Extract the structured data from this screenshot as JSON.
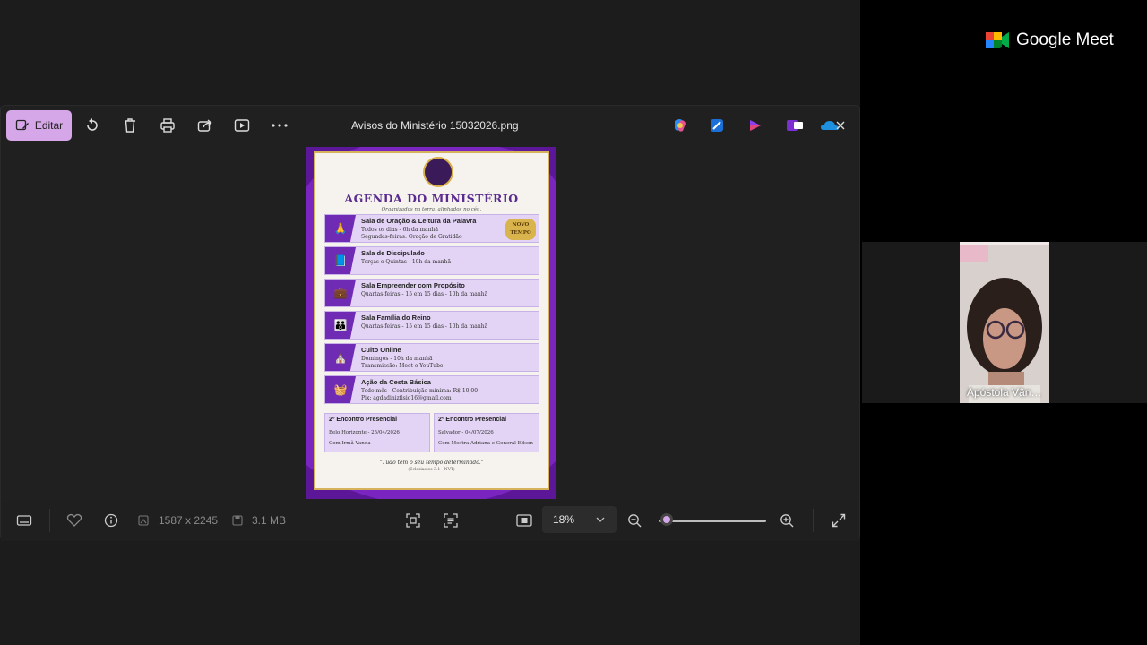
{
  "meet": {
    "brand": "Google Meet",
    "participant_name": "Apóstola Vân…"
  },
  "viewer": {
    "edit_label": "Editar",
    "filename": "Avisos do Ministério 15032026.png",
    "dimensions": "1587 x 2245",
    "filesize": "3.1 MB",
    "zoom": "18%",
    "zoom_level": 0.03
  },
  "poster": {
    "title": "AGENDA DO MINISTÉRIO",
    "subtitle": "Organizados na terra, alinhados no céu.",
    "badge": "NOVO TEMPO",
    "rows": [
      {
        "title": "Sala de Oração & Leitura da Palavra",
        "l1": "Todos os dias - 6h da manhã",
        "l2": "Segundas-feiras: Oração de Gratidão",
        "icon": "praying-hands-icon",
        "glyph": "🙏"
      },
      {
        "title": "Sala de Discipulado",
        "l1": "Terças e Quintas - 10h da manhã",
        "l2": "",
        "icon": "book-icon",
        "glyph": "📘"
      },
      {
        "title": "Sala Empreender com Propósito",
        "l1": "Quartas-feiras - 15 em 15 dias - 10h da manhã",
        "l2": "",
        "icon": "briefcase-icon",
        "glyph": "💼"
      },
      {
        "title": "Sala Família do Reino",
        "l1": "Quartas-feiras - 15 em 15 dias - 10h da manhã",
        "l2": "",
        "icon": "family-icon",
        "glyph": "👪"
      },
      {
        "title": "Culto Online",
        "l1": "Domingos - 10h da manhã",
        "l2": "Transmissão: Meet e YouTube",
        "icon": "church-icon",
        "glyph": "⛪"
      },
      {
        "title": "Ação da Cesta Básica",
        "l1": "Todo mês - Contribuição mínima: R$ 10,00",
        "l2": "Pix: agdadinizfisio16@gmail.com",
        "icon": "basket-icon",
        "glyph": "🧺"
      }
    ],
    "encontros": [
      {
        "title": "2º Encontro Presencial",
        "place": "Belo Horizonte - 25/04/2026",
        "with": "Com Irmã Vanda"
      },
      {
        "title": "2º Encontro Presencial",
        "place": "Salvador - 04/07/2026",
        "with": "Com Mestra Adriana e General Edson"
      }
    ],
    "quote": "\"Tudo tem o seu tempo determinado.\"",
    "quote_ref": "(Eclesiastes 3:1 - NVT)"
  }
}
